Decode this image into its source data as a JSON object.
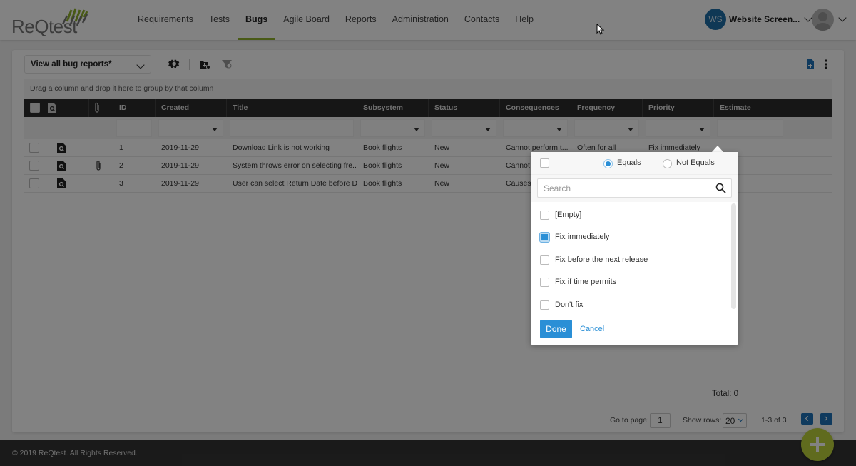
{
  "header": {
    "logo_text": "ReQtest",
    "nav": [
      {
        "label": "Requirements",
        "active": false
      },
      {
        "label": "Tests",
        "active": false
      },
      {
        "label": "Bugs",
        "active": true
      },
      {
        "label": "Agile Board",
        "active": false
      },
      {
        "label": "Reports",
        "active": false
      },
      {
        "label": "Administration",
        "active": false
      },
      {
        "label": "Contacts",
        "active": false
      },
      {
        "label": "Help",
        "active": false
      }
    ],
    "user_initials": "WS",
    "user_name": "Website Screen...",
    "accent_color": "#8fb02c"
  },
  "toolbar": {
    "view_select": "View all bug reports*",
    "icons": [
      "gear-icon",
      "export-icon",
      "clear-filter-icon",
      "new-document-icon",
      "more-vertical-icon"
    ]
  },
  "grid": {
    "group_hint": "Drag a column and drop it here to group by that column",
    "columns": [
      "",
      "",
      "",
      "ID",
      "Created",
      "Title",
      "Subsystem",
      "Status",
      "Consequences",
      "Frequency",
      "Priority",
      "Estimate"
    ],
    "rows": [
      {
        "id": "1",
        "created": "2019-11-29",
        "title": "Download Link is not working",
        "subsystem": "Book flights",
        "status": "New",
        "consequences": "Cannot perform t...",
        "frequency": "Often for all",
        "priority": "Fix immediately",
        "estimate": "",
        "attachment": false
      },
      {
        "id": "2",
        "created": "2019-11-29",
        "title": "System throws error on selecting fre...",
        "subsystem": "Book flights",
        "status": "New",
        "consequences": "Cannot",
        "frequency": "",
        "priority": "",
        "estimate": "",
        "attachment": true
      },
      {
        "id": "3",
        "created": "2019-11-29",
        "title": "User can select Return Date before D...",
        "subsystem": "Book flights",
        "status": "New",
        "consequences": "Causes",
        "frequency": "",
        "priority": "",
        "estimate": "",
        "attachment": false
      }
    ],
    "total": "Total: 0"
  },
  "pager": {
    "goto_label": "Go to page:",
    "page": "1",
    "rows_label": "Show rows:",
    "rows": "20",
    "range": "1-3 of 3"
  },
  "filter_popup": {
    "equals": "Equals",
    "not_equals": "Not Equals",
    "mode": "Equals",
    "search_placeholder": "Search",
    "options": [
      {
        "label": "[Empty]",
        "checked": false
      },
      {
        "label": "Fix immediately",
        "checked": true
      },
      {
        "label": "Fix before the next release",
        "checked": false
      },
      {
        "label": "Fix if time permits",
        "checked": false
      },
      {
        "label": "Don't fix",
        "checked": false
      }
    ],
    "done": "Done",
    "cancel": "Cancel"
  },
  "footer": {
    "copyright": "© 2019 ReQtest. All Rights Reserved."
  }
}
